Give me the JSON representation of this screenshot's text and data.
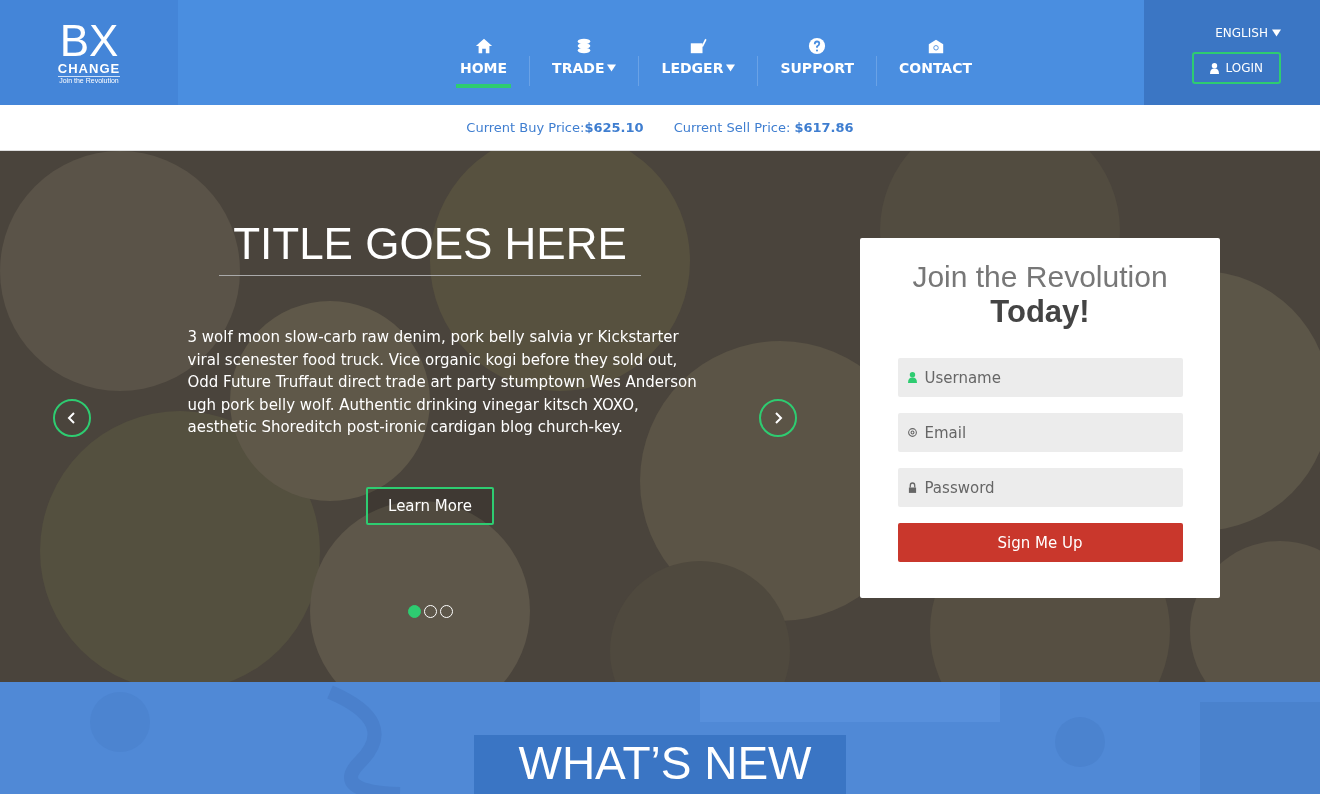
{
  "logo": {
    "mark": "BX",
    "word": "CHANGE",
    "tagline": "Join the Revolution"
  },
  "nav": [
    {
      "label": "HOME",
      "kind": "home",
      "dropdown": false,
      "selected": true
    },
    {
      "label": "TRADE",
      "kind": "coins",
      "dropdown": true,
      "selected": false
    },
    {
      "label": "LEDGER",
      "kind": "ledger",
      "dropdown": true,
      "selected": false
    },
    {
      "label": "SUPPORT",
      "kind": "help",
      "dropdown": false,
      "selected": false
    },
    {
      "label": "CONTACT",
      "kind": "mail",
      "dropdown": false,
      "selected": false
    }
  ],
  "language": "ENGLISH",
  "login": "LOGIN",
  "prices": [
    {
      "label": "Current Buy Price:",
      "value": "$625.10"
    },
    {
      "label": "Current Sell Price: ",
      "value": "$617.86"
    }
  ],
  "hero": {
    "title": "TITLE GOES HERE",
    "body": "3 wolf moon slow-carb raw denim, pork belly salvia yr Kickstarter viral scenester food truck.  Vice organic kogi before they sold out, Odd Future Truffaut direct trade  art party stumptown Wes Anderson ugh pork belly wolf.  Authentic drinking vinegar kitsch XOXO, aesthetic Shoreditch post-ironic cardigan blog church-key.",
    "button": "Learn More",
    "dots": [
      {
        "selected": true
      },
      {
        "selected": false
      },
      {
        "selected": false
      }
    ]
  },
  "signup": {
    "title": "Join the Revolution",
    "title_bold": "Today!",
    "fields": [
      {
        "placeholder": "Username",
        "kind": "user"
      },
      {
        "placeholder": "Email",
        "kind": "email"
      },
      {
        "placeholder": "Password",
        "kind": "password"
      }
    ],
    "button": "Sign Me Up"
  },
  "section": {
    "heading": "WHAT’S NEW"
  }
}
